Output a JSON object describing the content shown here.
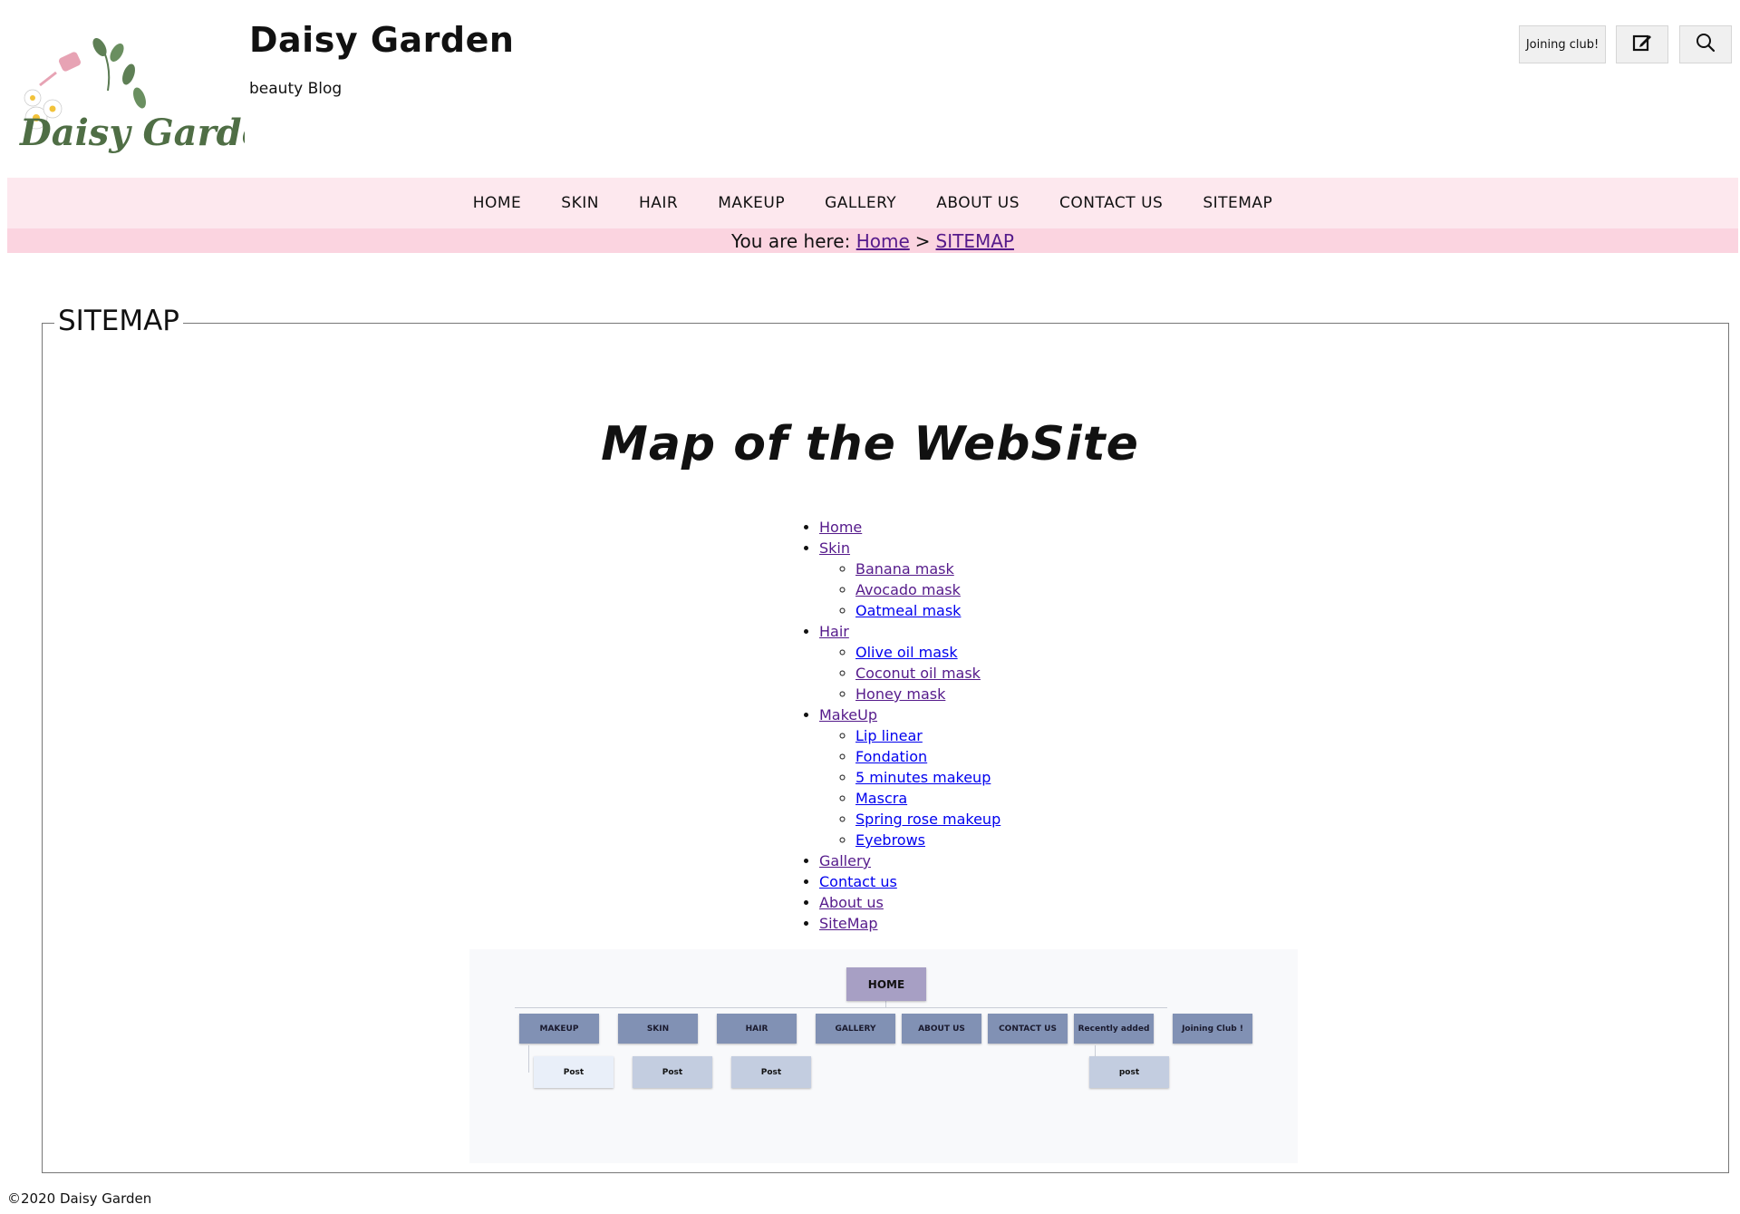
{
  "header": {
    "logo_text": "Daisy Garden",
    "title": "Daisy Garden",
    "tagline": "beauty Blog",
    "join_label": "Joining club!",
    "edit_icon": "edit-icon",
    "search_icon": "search-icon"
  },
  "nav": {
    "items": [
      "HOME",
      "SKIN",
      "HAIR",
      "MAKEUP",
      "GALLERY",
      "ABOUT US",
      "CONTACT US",
      "SITEMAP"
    ]
  },
  "breadcrumb": {
    "prefix": "You are here:",
    "home": "Home",
    "separator": ">",
    "current": "SITEMAP"
  },
  "main": {
    "legend": "SITEMAP",
    "heading": "Map of the WebSite"
  },
  "sitemap": {
    "home": "Home",
    "skin": "Skin",
    "skin_items": [
      "Banana mask",
      "Avocado mask",
      "Oatmeal mask"
    ],
    "hair": "Hair",
    "hair_items": [
      "Olive oil mask",
      "Coconut oil mask",
      "Honey mask"
    ],
    "makeup": "MakeUp",
    "makeup_items": [
      "Lip linear",
      "Fondation",
      "5 minutes makeup",
      "Mascra",
      "Spring rose makeup",
      "Eyebrows"
    ],
    "gallery": "Gallery",
    "contact": "Contact us",
    "about": "About us",
    "sitemap": "SiteMap"
  },
  "diagram": {
    "root": "HOME",
    "level1": [
      "MAKEUP",
      "SKIN",
      "HAIR",
      "GALLERY",
      "ABOUT US",
      "CONTACT US",
      "Recently added",
      "Joining Club !"
    ],
    "posts": [
      "Post",
      "Post",
      "Post",
      "post"
    ]
  },
  "footer": {
    "copyright": "©2020 Daisy Garden"
  },
  "colors": {
    "nav_bg": "#fde8ee",
    "crumb_bg": "#fbd4e0",
    "link": "#0000ee",
    "visited": "#551a8b",
    "node_home": "#a79fc4",
    "node_level1": "#8191b4",
    "node_post": "#c3cde0"
  }
}
